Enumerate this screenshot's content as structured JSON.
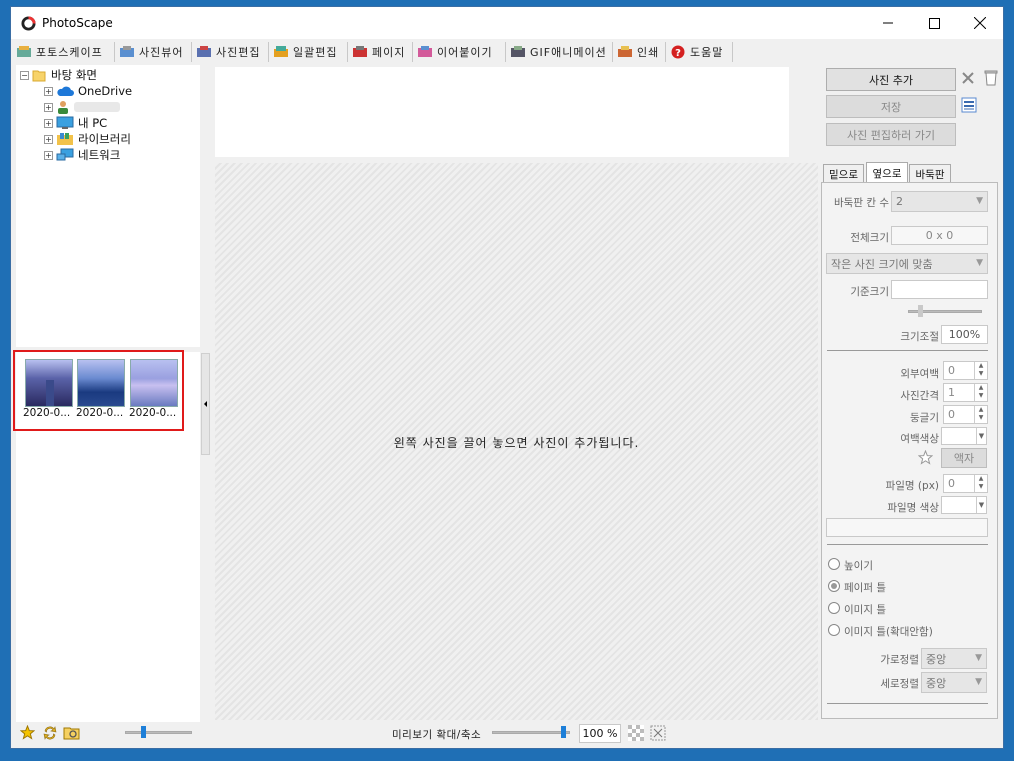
{
  "window": {
    "title": "PhotoScape",
    "minimize_icon": "minimize-icon",
    "maximize_icon": "maximize-icon",
    "close_icon": "close-icon"
  },
  "tabs": [
    {
      "label": "포토스케이프",
      "icon": "photoscape-home-icon"
    },
    {
      "label": "사진뷰어",
      "icon": "viewer-icon"
    },
    {
      "label": "사진편집",
      "icon": "editor-icon"
    },
    {
      "label": "일괄편집",
      "icon": "batch-icon"
    },
    {
      "label": "페이지",
      "icon": "page-icon"
    },
    {
      "label": "이어붙이기",
      "icon": "combine-icon"
    },
    {
      "label": "GIF애니메이션",
      "icon": "gif-icon"
    },
    {
      "label": "인쇄",
      "icon": "print-icon"
    },
    {
      "label": "도움말",
      "icon": "help-icon"
    }
  ],
  "tree": {
    "items": [
      {
        "label": "바탕 화면",
        "icon": "folder-icon"
      },
      {
        "label": "OneDrive",
        "icon": "cloud-icon"
      },
      {
        "label": "",
        "icon": "user-icon"
      },
      {
        "label": "내 PC",
        "icon": "computer-icon"
      },
      {
        "label": "라이브러리",
        "icon": "library-icon"
      },
      {
        "label": "네트워크",
        "icon": "network-icon"
      }
    ]
  },
  "thumbnails": [
    {
      "caption": "2020-0..."
    },
    {
      "caption": "2020-0..."
    },
    {
      "caption": "2020-0..."
    }
  ],
  "canvas": {
    "hint": "왼쪽 사진을 끌어 놓으면 사진이 추가됩니다."
  },
  "right": {
    "add_photo": "사진 추가",
    "save": "저장",
    "go_edit": "사진 편집하러 가기",
    "tabs": [
      "밑으로",
      "옆으로",
      "바둑판"
    ],
    "active_tab": "옆으로",
    "cols_label": "바둑판 칸 수",
    "cols_value": "2",
    "total_size_label": "전체크기",
    "total_size_value": "0 x 0",
    "fit_option": "작은 사진 크기에 맞춤",
    "base_size_label": "기준크기",
    "base_size_value": "",
    "scale_label": "크기조절",
    "scale_value": "100%",
    "outer_margin_label": "외부여백",
    "outer_margin_value": "0",
    "spacing_label": "사진간격",
    "spacing_value": "1",
    "round_label": "둥글기",
    "round_value": "0",
    "margin_color_label": "여백색상",
    "frame_button": "액자",
    "filename_px_label": "파일명 (px)",
    "filename_px_value": "0",
    "filename_color_label": "파일명 색상",
    "filename_text": "",
    "radio_options": [
      "높이기",
      "페이퍼 틀",
      "이미지 틀",
      "이미지 틀(확대안함)"
    ],
    "radio_selected": "페이퍼 틀",
    "h_align_label": "가로정렬",
    "h_align_value": "중앙",
    "v_align_label": "세로정렬",
    "v_align_value": "중앙"
  },
  "bottom": {
    "zoom_label": "미리보기 확대/축소",
    "zoom_value": "100 %",
    "thumb_slider_level": 0.25,
    "zoom_slider_level": 0.95
  },
  "colors": {
    "accent": "#1e7fd8",
    "selection_box": "#e01a1a",
    "desktop": "#1f6fb5"
  }
}
